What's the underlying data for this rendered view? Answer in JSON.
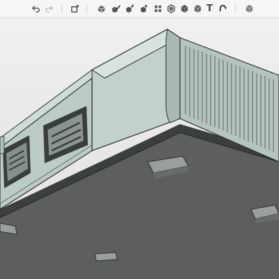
{
  "toolbar": {
    "tools": [
      {
        "name": "undo-button",
        "icon": "undo-arrow-icon"
      },
      {
        "name": "redo-button",
        "icon": "redo-arrow-icon",
        "disabled": true
      },
      {
        "name": "add-component-button",
        "icon": "add-box-icon"
      },
      {
        "name": "fillet-button",
        "icon": "fillet-cube-icon"
      },
      {
        "name": "sketch-button",
        "icon": "pencil-cube-icon"
      },
      {
        "name": "paint-button",
        "icon": "brush-cube-icon"
      },
      {
        "name": "transform-button",
        "icon": "move-cube-icon"
      },
      {
        "name": "pattern-button",
        "icon": "pattern-grid-icon"
      },
      {
        "name": "shell-button",
        "icon": "shell-cube-icon"
      },
      {
        "name": "boolean-button",
        "icon": "solid-cube-icon"
      },
      {
        "name": "text-button",
        "icon": "text-icon",
        "label": "T"
      },
      {
        "name": "bend-button",
        "icon": "bend-icon"
      },
      {
        "name": "render-button",
        "icon": "render-cube-icon"
      }
    ]
  },
  "colors": {
    "body_face": "#bdcbc8",
    "body_face_light": "#c9d6d3",
    "panel_face": "#c3d0cd",
    "fin_dark": "#9aa9a6",
    "base_plate": "#5b5d5e",
    "base_plate_dark": "#4a4c4d",
    "foot": "#9a9c9c",
    "outline": "#2a2e2e"
  }
}
